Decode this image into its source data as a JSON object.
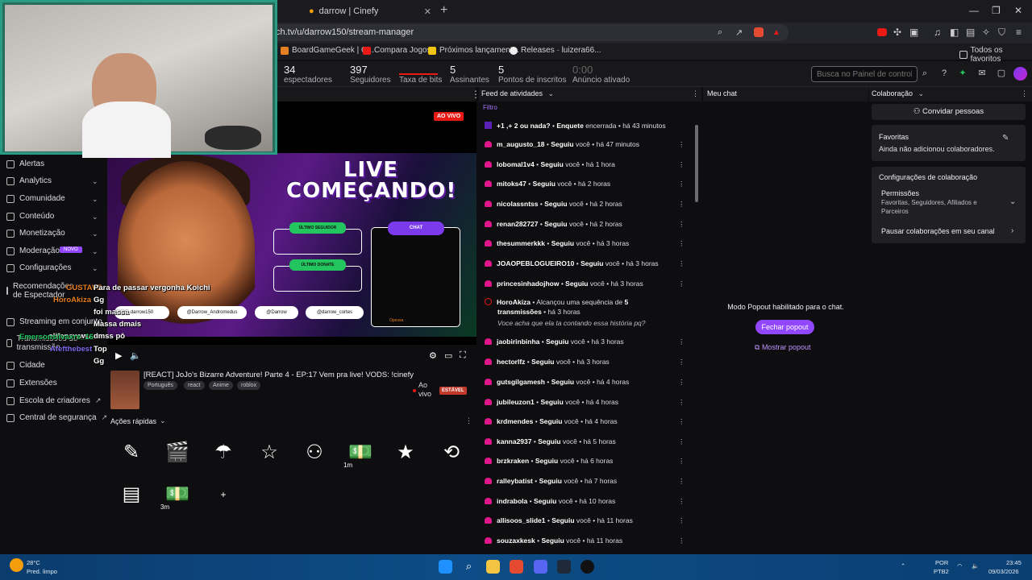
{
  "browser": {
    "tab_title": "darrow | Cinefy",
    "url": "ch.tv/u/darrow150/stream-manager",
    "new_tab": "+",
    "bookmarks": [
      "BoardGameGeek | G...",
      "Compara Jogos",
      "Próximos lançament...",
      "Releases · luizera66..."
    ],
    "all_favorites": "Todos os favoritos"
  },
  "stats": [
    {
      "value": "34",
      "label": "espectadores"
    },
    {
      "value": "397",
      "label": "Seguidores"
    },
    {
      "value": "",
      "label": "Taxa de bits"
    },
    {
      "value": "5",
      "label": "Assinantes"
    },
    {
      "value": "5",
      "label": "Pontos de inscritos"
    },
    {
      "value": "0:00",
      "label": "Anúncio ativado"
    }
  ],
  "dashboard_search": {
    "placeholder": "Busca no Painel de controle (/)"
  },
  "sidebar": [
    {
      "label": "Alertas"
    },
    {
      "label": "Analytics"
    },
    {
      "label": "Comunidade"
    },
    {
      "label": "Conteúdo"
    },
    {
      "label": "Monetização"
    },
    {
      "label": "Moderação"
    },
    {
      "label": "Configurações"
    },
    {
      "label": "Recomendações de Espectador"
    },
    {
      "label": "Streaming em conjunto"
    },
    {
      "label": "Transmissões de transmissão"
    },
    {
      "label": "Cidade"
    },
    {
      "label": "Extensões"
    },
    {
      "label": "Escola de criadores"
    },
    {
      "label": "Central de segurança"
    }
  ],
  "new_badge": "NOVO",
  "player": {
    "live_badge": "AO VIVO",
    "title_line1": "LIVE",
    "title_line2": "COMEÇANDO!",
    "last_follower": "ÚLTIMO SEGUIDOR",
    "last_donate": "ÚLTIMO DONATE",
    "chat": "CHAT",
    "socials": [
      "darrow150",
      "@Darrow_Andromedus",
      "@Darrow",
      "@darrow_cortes"
    ],
    "chat_footer": "Opessa"
  },
  "stream_info": {
    "title": "[REACT] JoJo's Bizarre Adventure! Parte 4 - EP:17 Vem pra live! VODS: !cinefy",
    "tags": [
      "Português",
      "react",
      "Anime",
      "roblox"
    ],
    "status": "Ao vivo",
    "stable": "ESTÁVEL"
  },
  "quick_actions": {
    "title": "Ações rápidas",
    "items": [
      {
        "icon": "pencil",
        "color": "#b5179e",
        "label": ""
      },
      {
        "icon": "clapper",
        "color": "#b5179e",
        "label": ""
      },
      {
        "icon": "parachute",
        "color": "#b5179e",
        "label": ""
      },
      {
        "icon": "star-outline",
        "color": "#b5179e",
        "label": ""
      },
      {
        "icon": "add-user",
        "color": "#b5179e",
        "label": ""
      },
      {
        "icon": "ad-cash",
        "color": "#18a34a",
        "label": "1m"
      },
      {
        "icon": "star-filled",
        "color": "#2563eb",
        "label": ""
      },
      {
        "icon": "clock-reset",
        "color": "#b5179e",
        "label": ""
      },
      {
        "icon": "split",
        "color": "#b5179e",
        "label": ""
      },
      {
        "icon": "ad-cash",
        "color": "#18a34a",
        "label": "3m"
      },
      {
        "icon": "plus",
        "color": "#2a2a2e",
        "label": "+"
      }
    ]
  },
  "overlay_chat": [
    {
      "user": "GUSTAVE",
      "msg": "Para de passar vergonha Koichi",
      "color": "#e67e22"
    },
    {
      "user": "HoroAkiza",
      "msg": "Gg",
      "color": "#e67e22"
    },
    {
      "user": "",
      "msg": "foi massa",
      "color": "#7c6cf0"
    },
    {
      "user": "",
      "msg": "Massa dmais",
      "color": "#ffffff"
    },
    {
      "user": "olifanswww",
      "msg": "dmss pô",
      "color": "#ffffff"
    },
    {
      "user": "Emersonsilvaxrs_16",
      "msg": "Top",
      "color": "#22c55e"
    },
    {
      "user": "Afefthebest",
      "msg": "Gg",
      "color": "#7c6cf0"
    }
  ],
  "feed": {
    "title": "Feed de atividades",
    "filter": "Filtro",
    "poll": {
      "text": "+1 ,+ 2 ou nada?",
      "action": "Enquete",
      "state": "encerrada",
      "time": "há 43 minutos"
    },
    "streak": {
      "user": "HoroAkiza",
      "text": "Alcançou uma sequência de",
      "count": "5",
      "unit": "transmissões",
      "time": "há 3 horas",
      "comment": "Voce acha que ela ta contando essa história pq?"
    },
    "items": [
      {
        "user": "m_augusto_18",
        "action": "Seguiu",
        "obj": "você",
        "time": "há 47 minutos"
      },
      {
        "user": "lobomal1v4",
        "action": "Seguiu",
        "obj": "você",
        "time": "há 1 hora"
      },
      {
        "user": "mitoks47",
        "action": "Seguiu",
        "obj": "você",
        "time": "há 2 horas"
      },
      {
        "user": "nicolassntss",
        "action": "Seguiu",
        "obj": "você",
        "time": "há 2 horas"
      },
      {
        "user": "renan282727",
        "action": "Seguiu",
        "obj": "você",
        "time": "há 2 horas"
      },
      {
        "user": "thesummerkkk",
        "action": "Seguiu",
        "obj": "você",
        "time": "há 3 horas"
      },
      {
        "user": "JOAOPEBLOGUEIRO10",
        "action": "Seguiu",
        "obj": "você",
        "time": "há 3 horas"
      },
      {
        "user": "princesinhadojhow",
        "action": "Seguiu",
        "obj": "você",
        "time": "há 3 horas"
      },
      {
        "user": "jaobirinbinha",
        "action": "Seguiu",
        "obj": "você",
        "time": "há 3 horas"
      },
      {
        "user": "hectorlfz",
        "action": "Seguiu",
        "obj": "você",
        "time": "há 3 horas"
      },
      {
        "user": "gutsgilgamesh",
        "action": "Seguiu",
        "obj": "você",
        "time": "há 4 horas"
      },
      {
        "user": "jubileuzon1",
        "action": "Seguiu",
        "obj": "você",
        "time": "há 4 horas"
      },
      {
        "user": "krdmendes",
        "action": "Seguiu",
        "obj": "você",
        "time": "há 4 horas"
      },
      {
        "user": "kanna2937",
        "action": "Seguiu",
        "obj": "você",
        "time": "há 5 horas"
      },
      {
        "user": "brzkraken",
        "action": "Seguiu",
        "obj": "você",
        "time": "há 6 horas"
      },
      {
        "user": "ralleybatist",
        "action": "Seguiu",
        "obj": "você",
        "time": "há 7 horas"
      },
      {
        "user": "indrabola",
        "action": "Seguiu",
        "obj": "você",
        "time": "há 10 horas"
      },
      {
        "user": "allisoos_slide1",
        "action": "Seguiu",
        "obj": "você",
        "time": "há 11 horas"
      },
      {
        "user": "souzaxkesk",
        "action": "Seguiu",
        "obj": "você",
        "time": "há 11 horas"
      }
    ]
  },
  "mychat": {
    "title": "Meu chat",
    "popout_message": "Modo Popout habilitado para o chat.",
    "close_popout": "Fechar popout",
    "show_popout": "Mostrar popout"
  },
  "collab": {
    "title": "Colaboração",
    "invite": "Convidar pessoas",
    "favorites_title": "Favoritas",
    "favorites_empty": "Ainda não adicionou colaboradores.",
    "settings_title": "Configurações de colaboração",
    "permissions_title": "Permissões",
    "permissions_desc1": "Favoritas, Seguidores, Afiliados e",
    "permissions_desc2": "Parceiros",
    "pause": "Pausar colaborações em seu canal"
  },
  "taskbar": {
    "weather_temp": "28°C",
    "weather_desc": "Pred. limpo",
    "lang1": "POR",
    "lang2": "PTB2",
    "time": "23:45",
    "date": "09/03/2026"
  },
  "colors": {
    "accent": "#9147ff",
    "live": "#e91916",
    "heart": "#e0178a"
  }
}
